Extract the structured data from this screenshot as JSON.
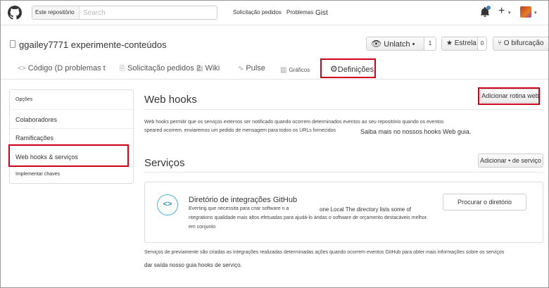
{
  "header": {
    "scope_label": "Este repositório",
    "search_placeholder": "Search",
    "nav": [
      "Solicitação pedidos",
      "Problemas",
      "Gist"
    ],
    "plus_label": "+"
  },
  "repo": {
    "title": "ggailey7771 experimente-conteúdos",
    "unwatch_label": "Unlatch •",
    "unwatch_count": "1",
    "star_label": "Estrela",
    "star_count": "0",
    "fork_label": "O bifurcação"
  },
  "tabs": [
    {
      "icon": "<>",
      "label": "Código (D problemas t"
    },
    {
      "icon": "⎘",
      "label": "Solicitação pedidos 2"
    },
    {
      "icon": "▤",
      "label": "Wiki"
    },
    {
      "icon": "∿",
      "label": "Pulse"
    },
    {
      "icon": "▥",
      "label": "Gráficos"
    },
    {
      "icon": "⚙",
      "label": "Definições"
    }
  ],
  "sidebar": {
    "items": [
      "Opções",
      "Colaboradores",
      "Ramificações",
      "Web hooks & serviços",
      "Implementar chaves"
    ]
  },
  "webhooks": {
    "title": "Web hooks",
    "add_button": "Adicionar rotina web",
    "desc_line1": "Web hooks permitir que os serviços externos ser notificado quando ocorrem determinados eventos ao seu repositório quando os eventos",
    "desc_line2": "speared ocorrem. enviaremos um pedido de mensagem para todos os URLs fornecidos",
    "learn_more": "Saiba mais no nossos hooks Web guia."
  },
  "services": {
    "title": "Serviços",
    "add_button": "Adicionar • de serviço",
    "card_title": "Diretório de integrações GitHub",
    "card_line1": "Everting que necessita para criar software n a",
    "card_extra": "one Local The directory lists some of",
    "card_line2": "ntegrations qualidade mais altos efetuadas para ajudá-lo áridas o software de orçamento destacáveis melhor.",
    "card_line3": "em conjunto",
    "browse_button": "Procurar o diretório",
    "footer_line1": "Serviços de previamente são criadas as integrações realizadas determinadas ações quando ocorrem eventos GitHub para obter mais informações sobre os serviços",
    "footer_line2": "dar saída nosso guia hooks de serviço."
  },
  "colors": {
    "accent": "#4183c4",
    "highlight": "#d0021b"
  }
}
